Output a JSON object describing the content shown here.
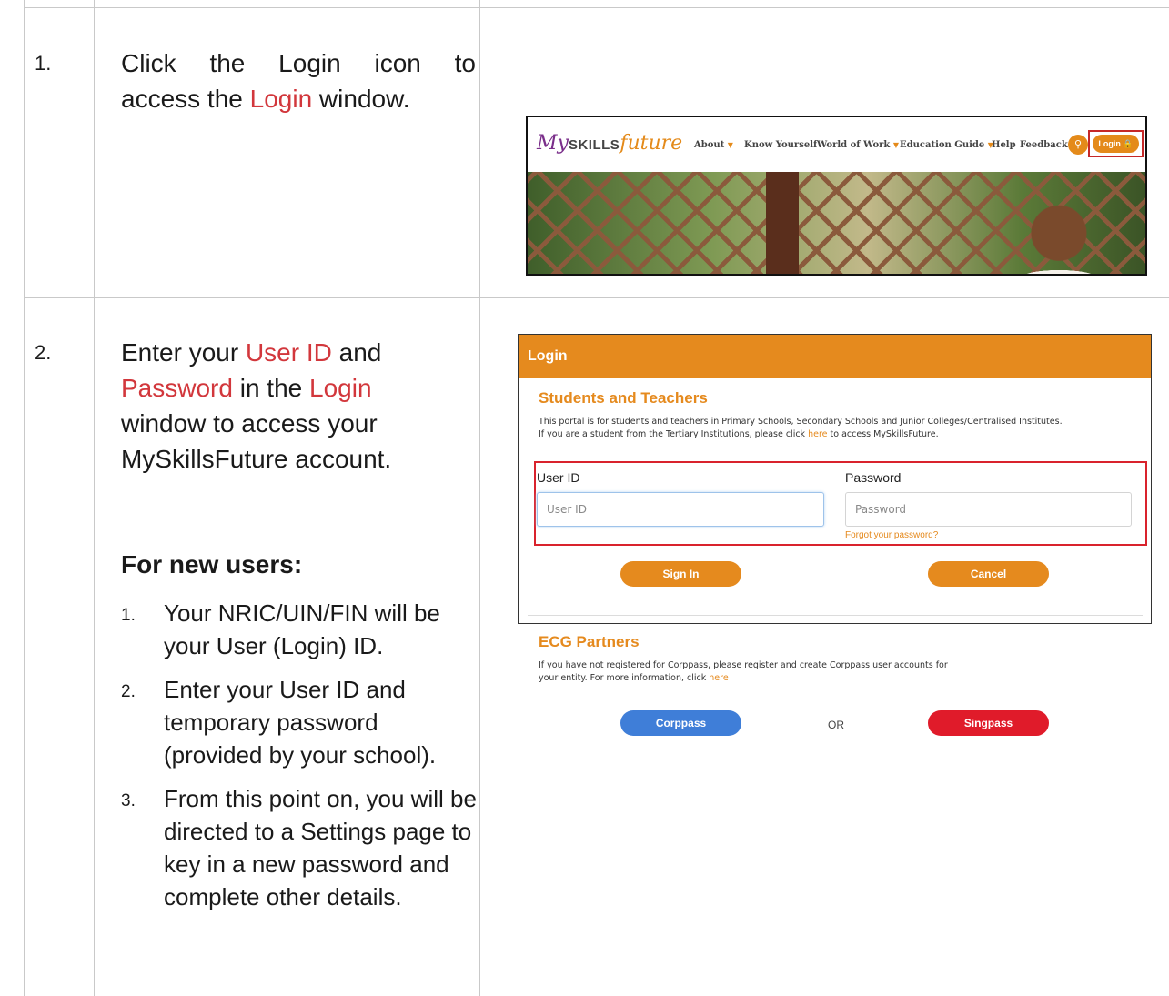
{
  "step1": {
    "number": "1.",
    "text_parts": [
      "Click the Login icon to",
      "access the ",
      "Login",
      " window."
    ]
  },
  "step2": {
    "number": "2.",
    "lines": [
      [
        "Enter your ",
        "User ID",
        " and"
      ],
      [
        "Password",
        " in the ",
        "Login"
      ],
      [
        "window to access your"
      ],
      [
        "MySkillsFuture account."
      ]
    ],
    "new_users_heading": "For new users:",
    "new_users_items": [
      {
        "num": "1.",
        "text": "Your NRIC/UIN/FIN will be your User (Login) ID."
      },
      {
        "num": "2.",
        "text": "Enter your User ID and temporary password (provided by your school)."
      },
      {
        "num": "3.",
        "text": "From this point on, you will be directed to a Settings page to key in a new password and complete other details."
      }
    ]
  },
  "site_header": {
    "logo": {
      "my": "My",
      "skills": "SKILLS",
      "future": "future"
    },
    "nav": [
      "About",
      "Know Yourself",
      "World of Work",
      "Education Guide",
      "Help",
      "Feedback"
    ],
    "login_label": "Login 🔒",
    "search_icon": "search-icon",
    "accent_color": "#e48a1a"
  },
  "login_dialog": {
    "title": "Login",
    "students_heading": "Students and Teachers",
    "students_p1": "This portal is for students and teachers in Primary Schools, Secondary Schools and Junior Colleges/Centralised Institutes.",
    "students_p2_before": "If you are a student from the Tertiary Institutions, please click ",
    "students_p2_link": "here",
    "students_p2_after": " to access MySkillsFuture.",
    "user_id_label": "User ID",
    "user_id_placeholder": "User ID",
    "password_label": "Password",
    "password_placeholder": "Password",
    "forgot_password": "Forgot your password?",
    "sign_in": "Sign In",
    "cancel": "Cancel",
    "ecg_heading": "ECG Partners",
    "ecg_p1": "If you have not registered for Corppass, please register and create Corppass user accounts for",
    "ecg_p2_before": "your entity. For more information, click ",
    "ecg_p2_link": "here",
    "corppass": "Corppass",
    "or": "OR",
    "singpass": "Singpass",
    "colors": {
      "orange": "#e58a1e",
      "blue": "#3f7ed8",
      "red": "#e01b2a",
      "highlight": "#d9232d"
    }
  }
}
